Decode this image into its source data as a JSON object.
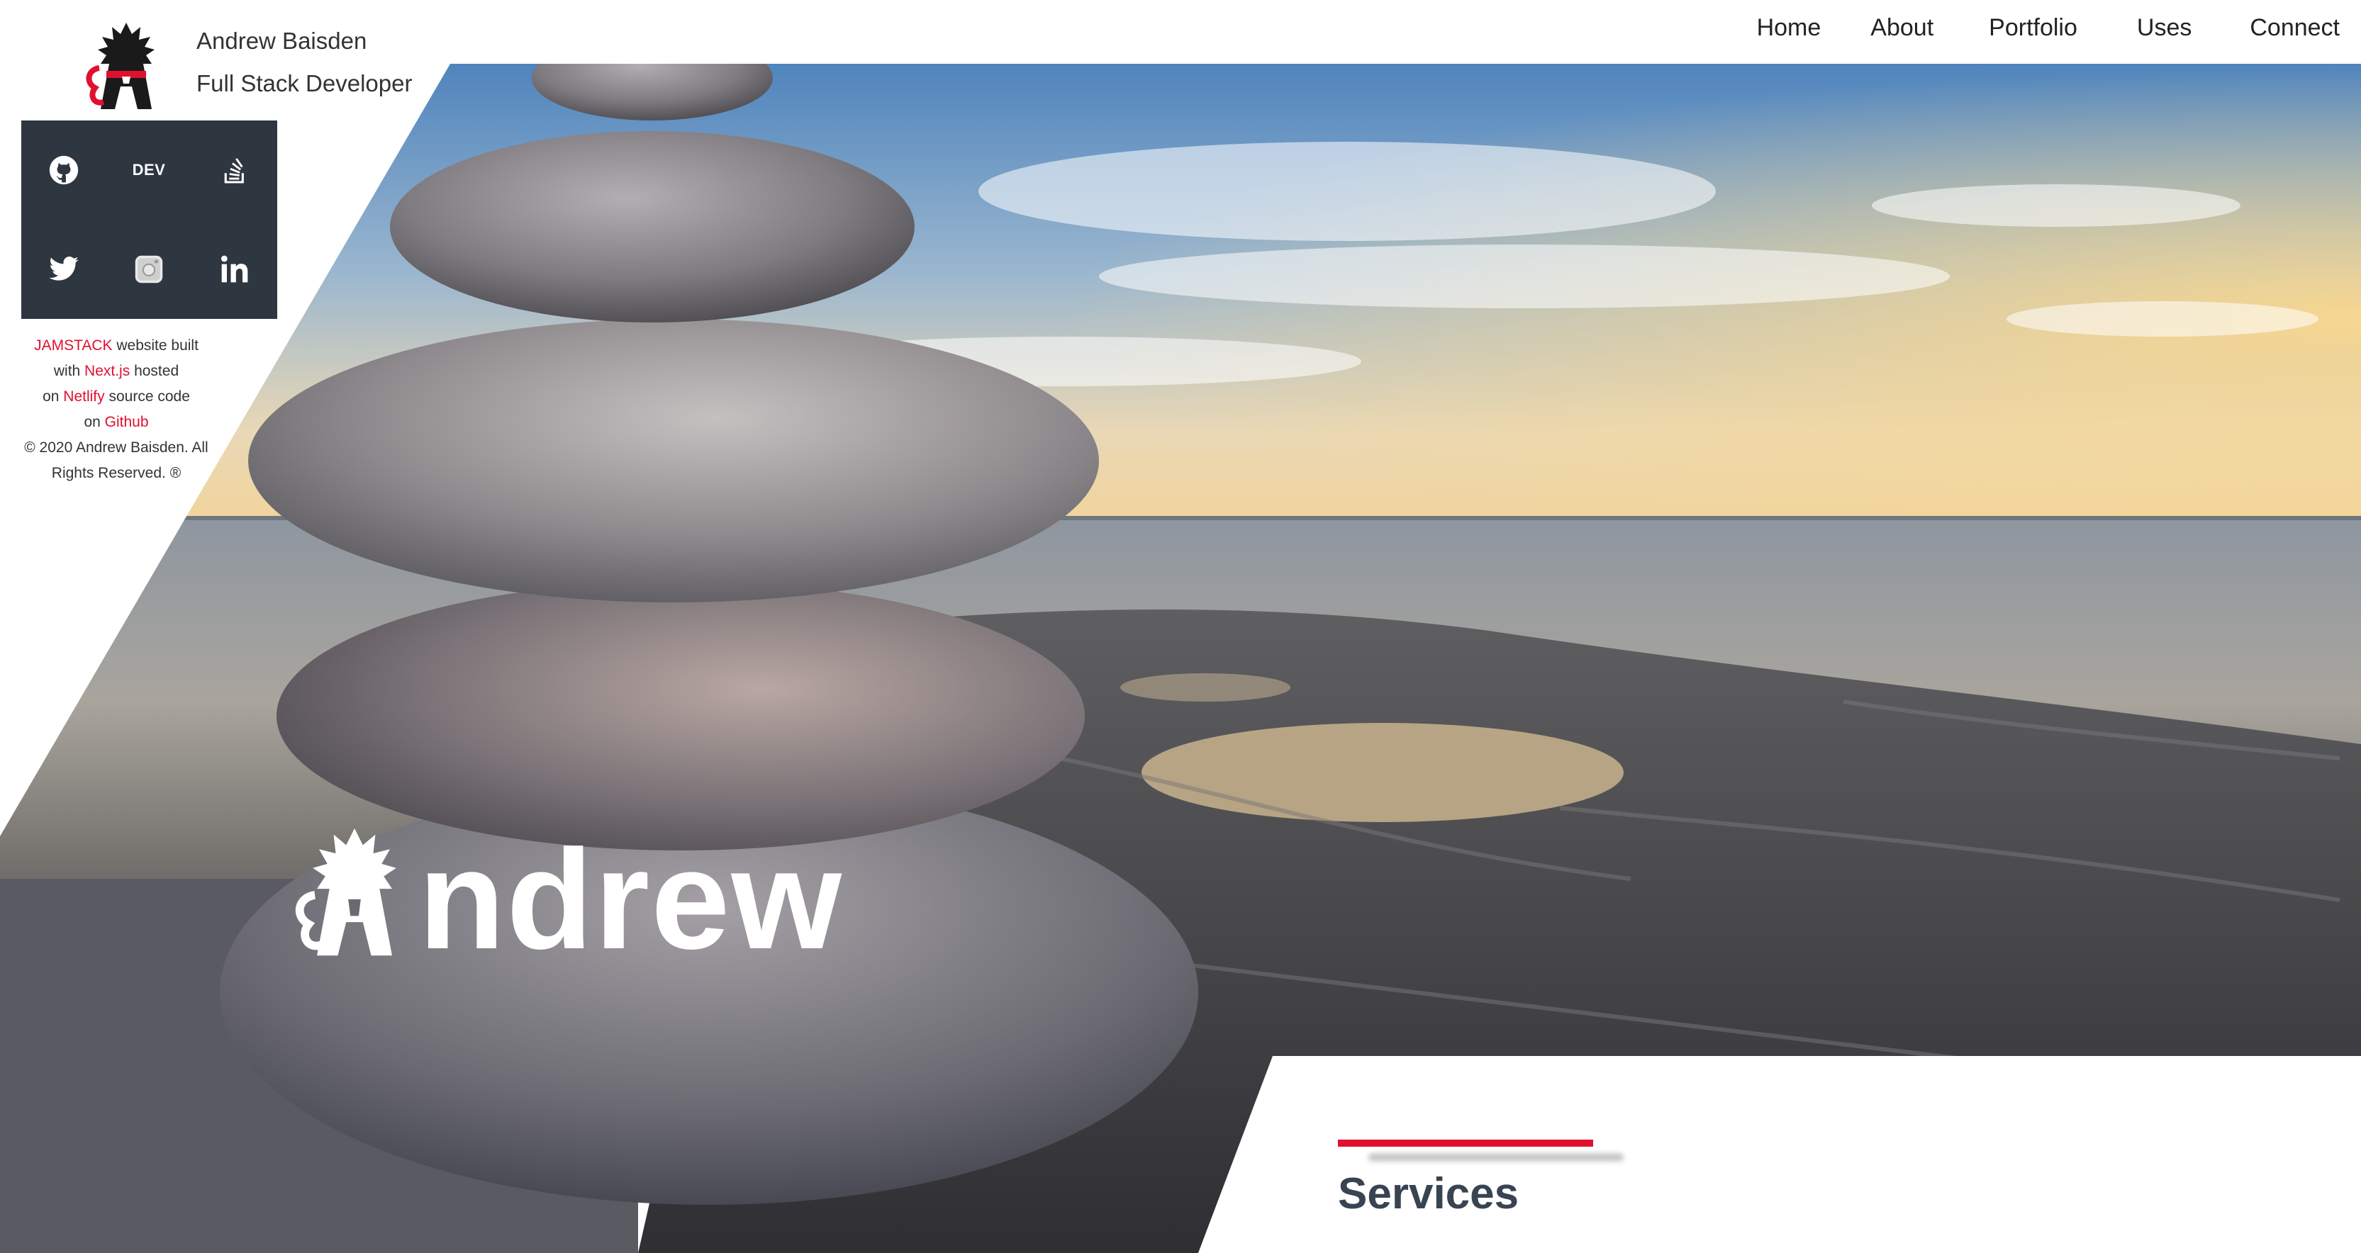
{
  "header": {
    "name": "Andrew Baisden",
    "title": "Full Stack Developer",
    "logo_icon": "andrew-a-logo"
  },
  "nav": {
    "items": [
      {
        "label": "Home"
      },
      {
        "label": "About"
      },
      {
        "label": "Portfolio"
      },
      {
        "label": "Uses"
      },
      {
        "label": "Connect"
      }
    ]
  },
  "social": {
    "items": [
      {
        "icon": "github-icon"
      },
      {
        "icon": "dev-icon",
        "label": "DEV"
      },
      {
        "icon": "stackoverflow-icon"
      },
      {
        "icon": "twitter-icon"
      },
      {
        "icon": "instagram-icon"
      },
      {
        "icon": "linkedin-icon",
        "label": "in"
      }
    ],
    "background": "#2e3640"
  },
  "credits": {
    "jamstack": "JAMSTACK",
    "website_built": " website built",
    "with": "with ",
    "nextjs": "Next.js",
    "hosted": " hosted",
    "on1": "on ",
    "netlify": "Netlify",
    "source_code": " source code",
    "on2": "on ",
    "github": "Github",
    "copyright": "© 2020 Andrew Baisden. All Rights Reserved. ®"
  },
  "hero": {
    "name": "ndrew"
  },
  "services": {
    "title": "Services"
  },
  "colors": {
    "accent": "#e0102f",
    "heading": "#384451"
  }
}
